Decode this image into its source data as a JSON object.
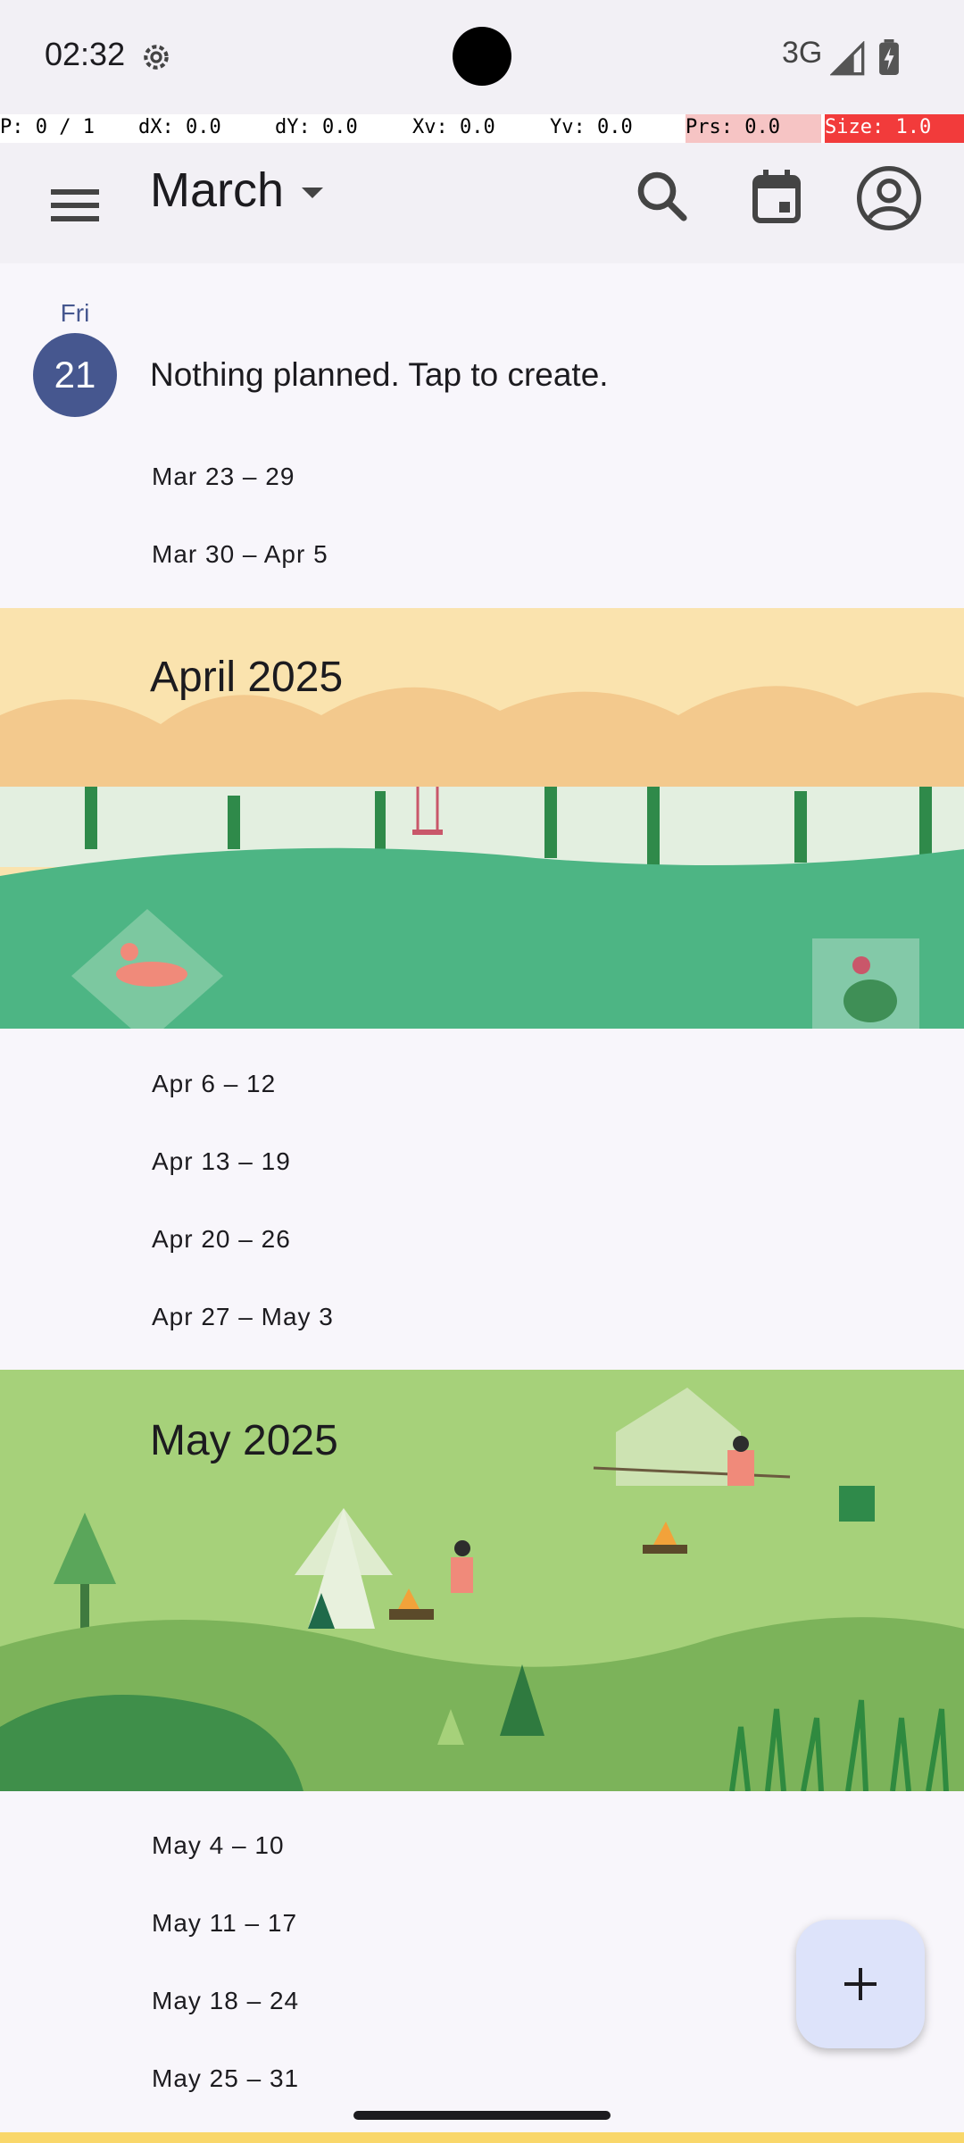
{
  "status_bar": {
    "time": "02:32",
    "network": "3G",
    "icons": [
      "settings-icon",
      "signal-icon",
      "battery-icon"
    ]
  },
  "debug": {
    "p": "P: 0 / 1",
    "dx": "dX: 0.0",
    "dy": "dY: 0.0",
    "xv": "Xv: 0.0",
    "yv": "Yv: 0.0",
    "prs": "Prs: 0.0",
    "size": "Size: 1.0"
  },
  "app_bar": {
    "month": "March",
    "icons": [
      "menu-icon",
      "search-icon",
      "calendar-today-icon",
      "account-icon"
    ]
  },
  "today": {
    "weekday": "Fri",
    "day": "21",
    "empty_message": "Nothing planned. Tap to create."
  },
  "march_weeks": [
    "Mar 23 – 29",
    "Mar 30 – Apr 5"
  ],
  "april": {
    "title": "April 2025",
    "weeks": [
      "Apr 6 – 12",
      "Apr 13 – 19",
      "Apr 20 – 26",
      "Apr 27 – May 3"
    ]
  },
  "may": {
    "title": "May 2025",
    "weeks": [
      "May 4 – 10",
      "May 11 – 17",
      "May 18 – 24",
      "May 25 – 31"
    ]
  },
  "fab": {
    "icon": "add-icon"
  },
  "colors": {
    "accent": "#46578f",
    "fab_bg": "#dde3fa",
    "april_sky": "#fae3ae",
    "april_grass": "#4db584",
    "may_grass": "#a6d17a"
  }
}
